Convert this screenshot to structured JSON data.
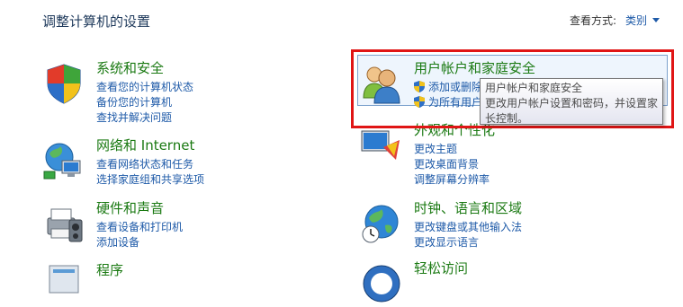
{
  "header": {
    "title": "调整计算机的设置",
    "view_by_label": "查看方式:",
    "view_by_value": "类别"
  },
  "categories": {
    "system": {
      "title": "系统和安全",
      "links": [
        "查看您的计算机状态",
        "备份您的计算机",
        "查找并解决问题"
      ]
    },
    "network": {
      "title": "网络和 Internet",
      "links": [
        "查看网络状态和任务",
        "选择家庭组和共享选项"
      ]
    },
    "hardware": {
      "title": "硬件和声音",
      "links": [
        "查看设备和打印机",
        "添加设备"
      ]
    },
    "programs": {
      "title": "程序"
    },
    "users": {
      "title": "用户帐户和家庭安全",
      "links": [
        "添加或删除",
        "为所有用户"
      ]
    },
    "appearance": {
      "title": "外观和个性化",
      "links": [
        "更改主题",
        "更改桌面背景",
        "调整屏幕分辨率"
      ]
    },
    "clock": {
      "title": "时钟、语言和区域",
      "links": [
        "更改键盘或其他输入法",
        "更改显示语言"
      ]
    },
    "ease": {
      "title": "轻松访问"
    }
  },
  "tooltip": {
    "line1": "用户帐户和家庭安全",
    "line2": "更改用户帐户设置和密码，并设置家",
    "line3": "长控制。"
  }
}
